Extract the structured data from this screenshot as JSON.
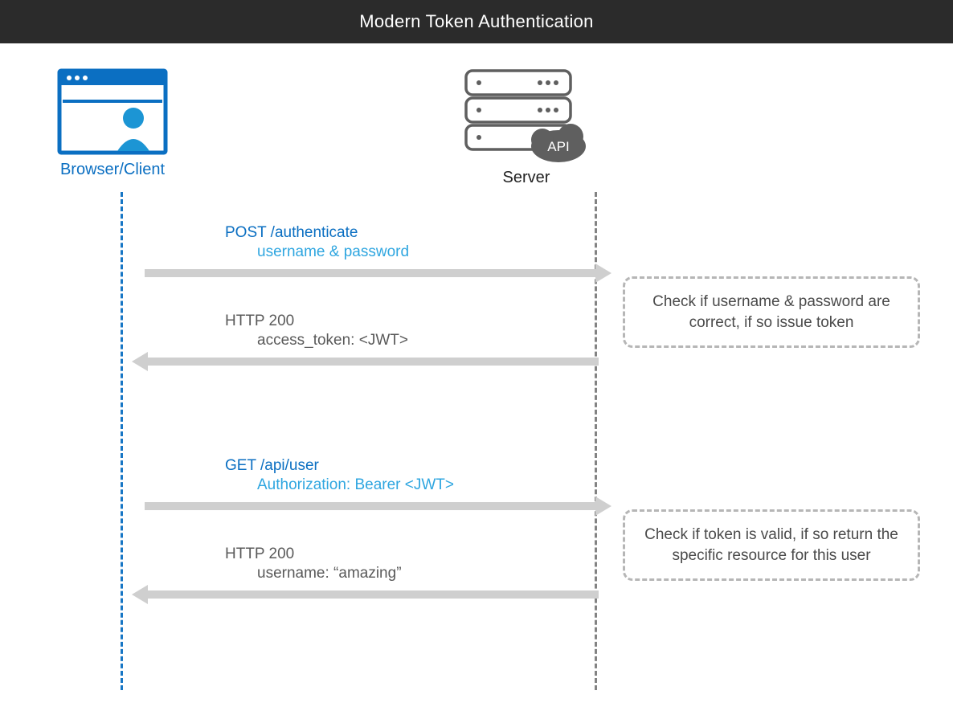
{
  "header": {
    "title": "Modern Token Authentication"
  },
  "actors": {
    "client": {
      "label": "Browser/Client"
    },
    "server": {
      "label": "Server",
      "api_badge": "API"
    }
  },
  "messages": [
    {
      "direction": "right",
      "title": "POST /authenticate",
      "subtitle": "username & password",
      "title_class": "blue-dark",
      "subtitle_class": "blue-light"
    },
    {
      "direction": "left",
      "title": "HTTP 200",
      "subtitle": "access_token: <JWT>",
      "title_class": "grey-text",
      "subtitle_class": "grey-text"
    },
    {
      "direction": "right",
      "title": "GET /api/user",
      "subtitle": "Authorization: Bearer <JWT>",
      "title_class": "blue-dark",
      "subtitle_class": "blue-light"
    },
    {
      "direction": "left",
      "title": "HTTP 200",
      "subtitle": "username: “amazing”",
      "title_class": "grey-text",
      "subtitle_class": "grey-text"
    }
  ],
  "notes": [
    {
      "text": "Check if username & password are correct, if so issue token"
    },
    {
      "text": "Check if token is valid, if so return the specific resource for this user"
    }
  ]
}
